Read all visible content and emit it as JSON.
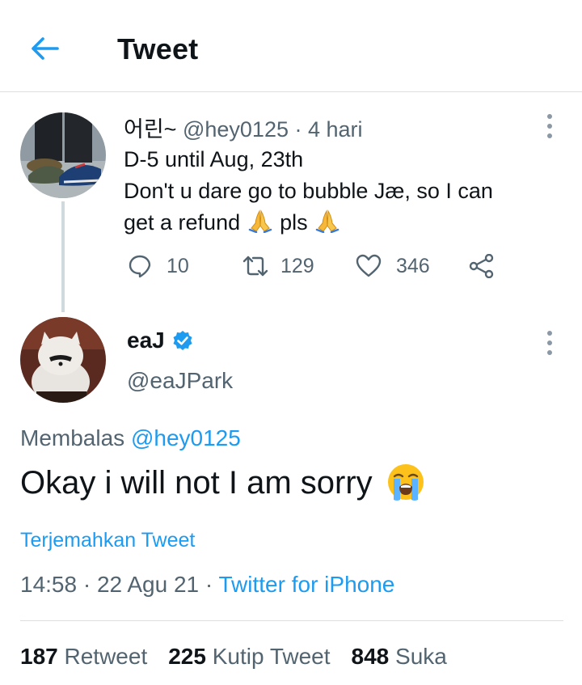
{
  "header": {
    "title": "Tweet",
    "back_icon": "arrow-left-icon",
    "accent": "#1d9bf0"
  },
  "parent_tweet": {
    "display_name": "어린~",
    "handle": "@hey0125",
    "time": "4 hari",
    "text_line1": "D-5 until Aug, 23th",
    "text_line2": "Don't u dare go to bubble Jæ, so I can",
    "text_line3a": "get a refund",
    "text_line3b": "pls",
    "emoji": "folded-hands-emoji",
    "replies": "10",
    "retweets": "129",
    "likes": "346"
  },
  "main_tweet": {
    "display_name": "eaJ",
    "verified_color": "#1d9bf0",
    "handle": "@eaJPark",
    "replying_label": "Membalas",
    "replying_to": "@hey0125",
    "text": "Okay i will not I am sorry",
    "emoji": "loudly-crying-face-emoji",
    "translate_label": "Terjemahkan Tweet",
    "time": "14:58",
    "date": "22 Agu 21",
    "source": "Twitter for iPhone",
    "stats": [
      {
        "count": "187",
        "label": "Retweet"
      },
      {
        "count": "225",
        "label": "Kutip Tweet"
      },
      {
        "count": "848",
        "label": "Suka"
      }
    ]
  }
}
